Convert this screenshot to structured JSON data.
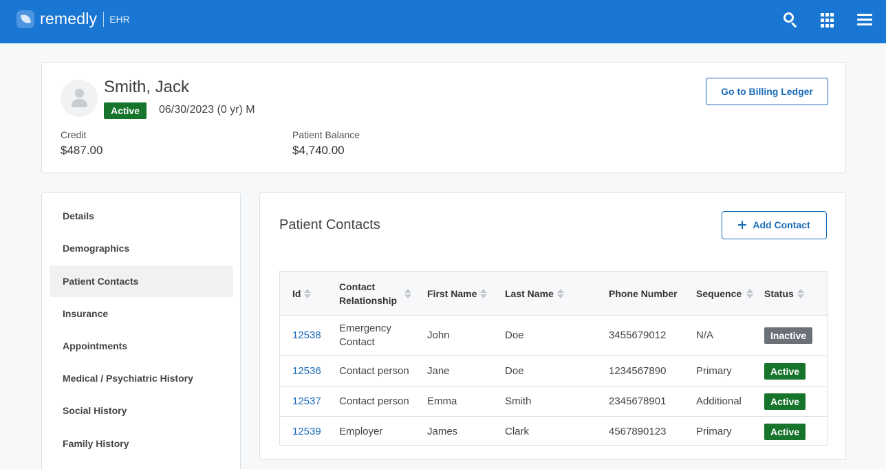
{
  "header": {
    "logo_text": "remedly",
    "logo_sub": "EHR",
    "icons": [
      "search-icon",
      "apps-grid-icon",
      "menu-icon"
    ]
  },
  "patient": {
    "name": "Smith, Jack",
    "status": "Active",
    "demographics": "06/30/2023 (0 yr) M",
    "credit_label": "Credit",
    "credit_value": "$487.00",
    "balance_label": "Patient Balance",
    "balance_value": "$4,740.00",
    "billing_button": "Go to Billing Ledger"
  },
  "sidebar": {
    "items": [
      {
        "label": "Details"
      },
      {
        "label": "Demographics"
      },
      {
        "label": "Patient Contacts",
        "active": true
      },
      {
        "label": "Insurance"
      },
      {
        "label": "Appointments"
      },
      {
        "label": "Medical / Psychiatric History"
      },
      {
        "label": "Social History"
      },
      {
        "label": "Family History"
      }
    ]
  },
  "main": {
    "title": "Patient Contacts",
    "add_button": "Add Contact",
    "columns": [
      "Id",
      "Contact Relationship",
      "First Name",
      "Last Name",
      "Phone Number",
      "Sequence",
      "Status"
    ],
    "rows": [
      {
        "id": "12538",
        "relationship": "Emergency Contact",
        "first": "John",
        "last": "Doe",
        "phone": "3455679012",
        "sequence": "N/A",
        "status": "Inactive"
      },
      {
        "id": "12536",
        "relationship": "Contact person",
        "first": "Jane",
        "last": "Doe",
        "phone": "1234567890",
        "sequence": "Primary",
        "status": "Active"
      },
      {
        "id": "12537",
        "relationship": "Contact person",
        "first": "Emma",
        "last": "Smith",
        "phone": "2345678901",
        "sequence": "Additional",
        "status": "Active"
      },
      {
        "id": "12539",
        "relationship": "Employer",
        "first": "James",
        "last": "Clark",
        "phone": "4567890123",
        "sequence": "Primary",
        "status": "Active"
      }
    ]
  },
  "colors": {
    "topbar": "#1976d2",
    "link": "#1a6bb8",
    "active_badge": "#17742b",
    "inactive_badge": "#6c7177"
  }
}
